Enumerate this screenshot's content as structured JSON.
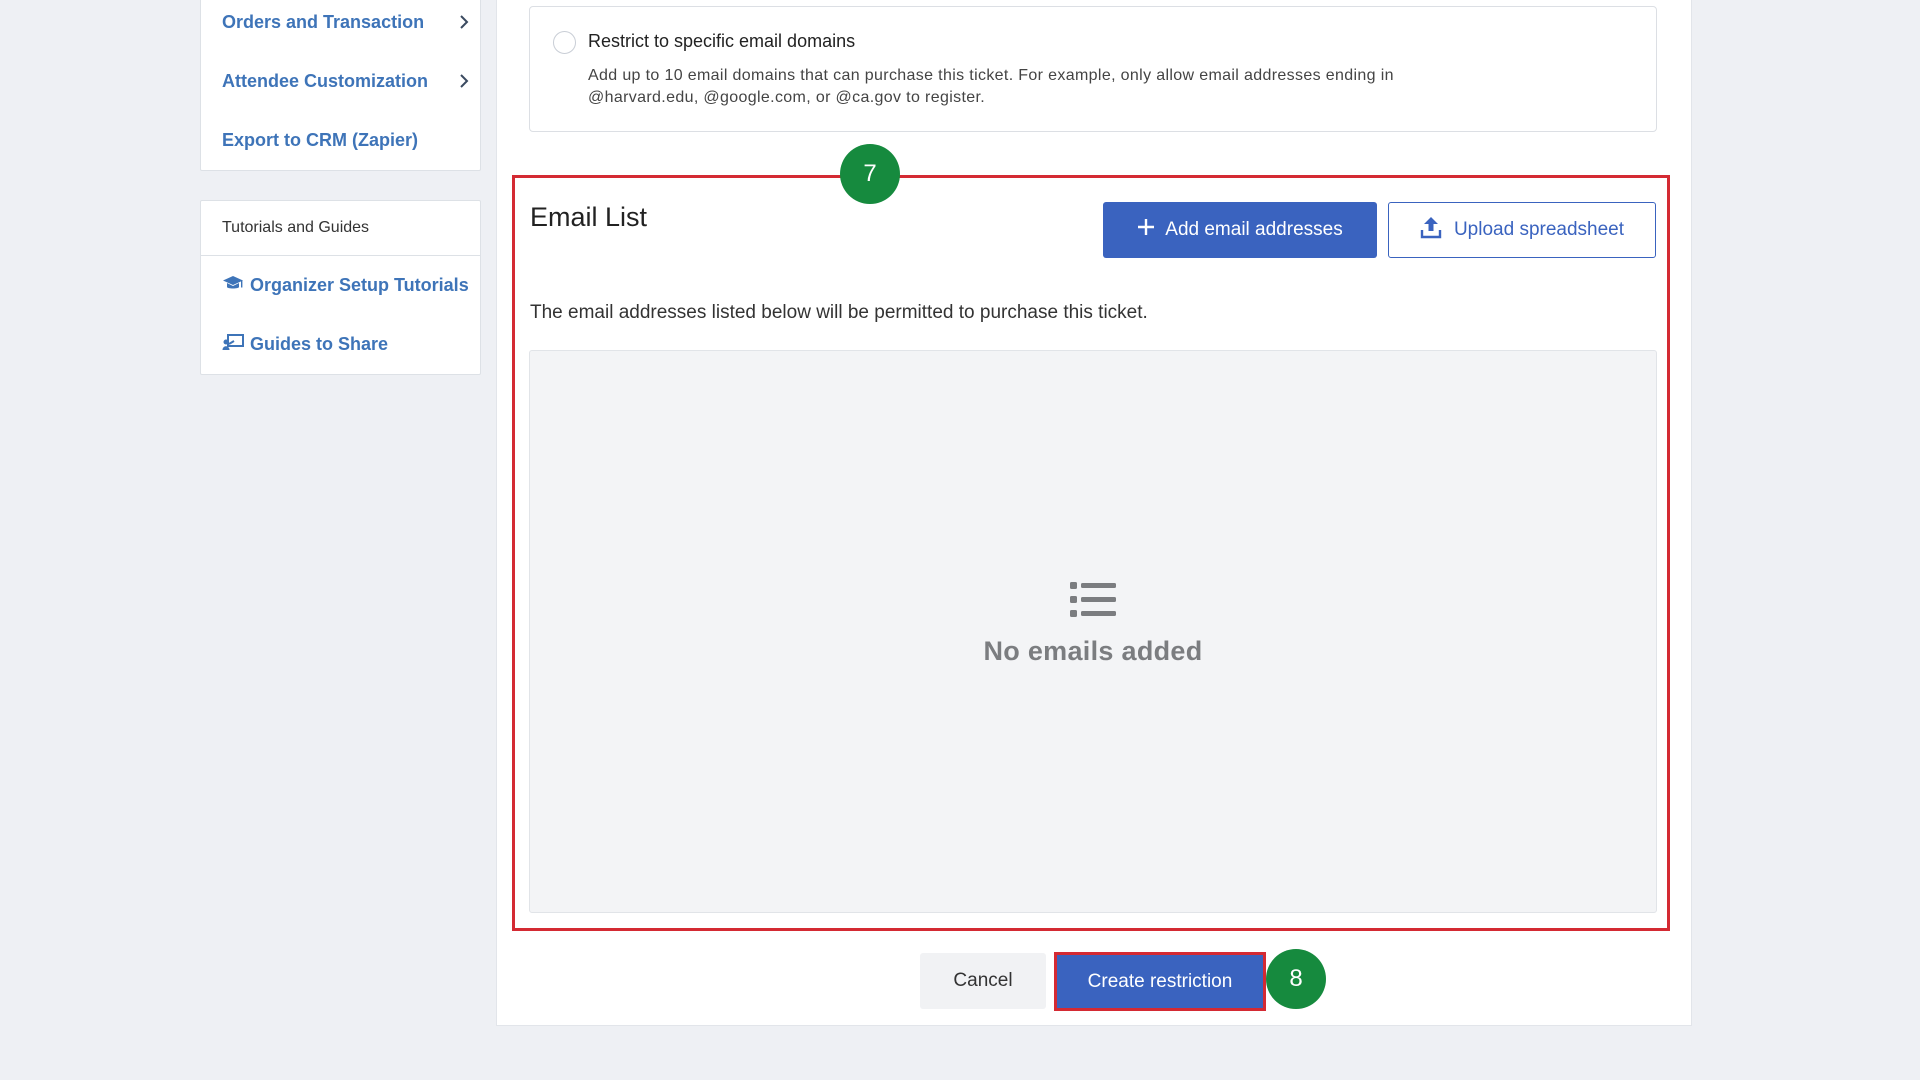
{
  "sidebar": {
    "nav_items": [
      {
        "label": "Orders and Transaction",
        "has_chevron": true
      },
      {
        "label": "Attendee Customization",
        "has_chevron": true
      },
      {
        "label": "Export to CRM (Zapier)",
        "has_chevron": false
      }
    ],
    "guides": {
      "heading": "Tutorials and Guides",
      "links": [
        {
          "label": "Organizer Setup Tutorials",
          "icon": "graduation-cap-icon"
        },
        {
          "label": "Guides to Share",
          "icon": "presentation-board-icon"
        }
      ]
    }
  },
  "domain_restriction": {
    "option_label": "Restrict to specific email domains",
    "description": "Add up to 10 email domains that can purchase this ticket. For example, only allow email addresses ending in @harvard.edu, @google.com, or @ca.gov to register.",
    "selected": false
  },
  "email_list": {
    "title": "Email List",
    "add_button": "Add email addresses",
    "upload_button": "Upload spreadsheet",
    "description": "The email addresses listed below will be permitted to purchase this ticket.",
    "empty_text": "No emails added",
    "empty_icon": "list-icon"
  },
  "footer": {
    "cancel_label": "Cancel",
    "create_label": "Create restriction"
  },
  "step_badges": {
    "email_list_step": "7",
    "create_step": "8"
  },
  "colors": {
    "link": "#3e74b8",
    "primary": "#3a63bf",
    "highlight": "#d42a33",
    "badge": "#168a3e",
    "background": "#eef0f4"
  }
}
